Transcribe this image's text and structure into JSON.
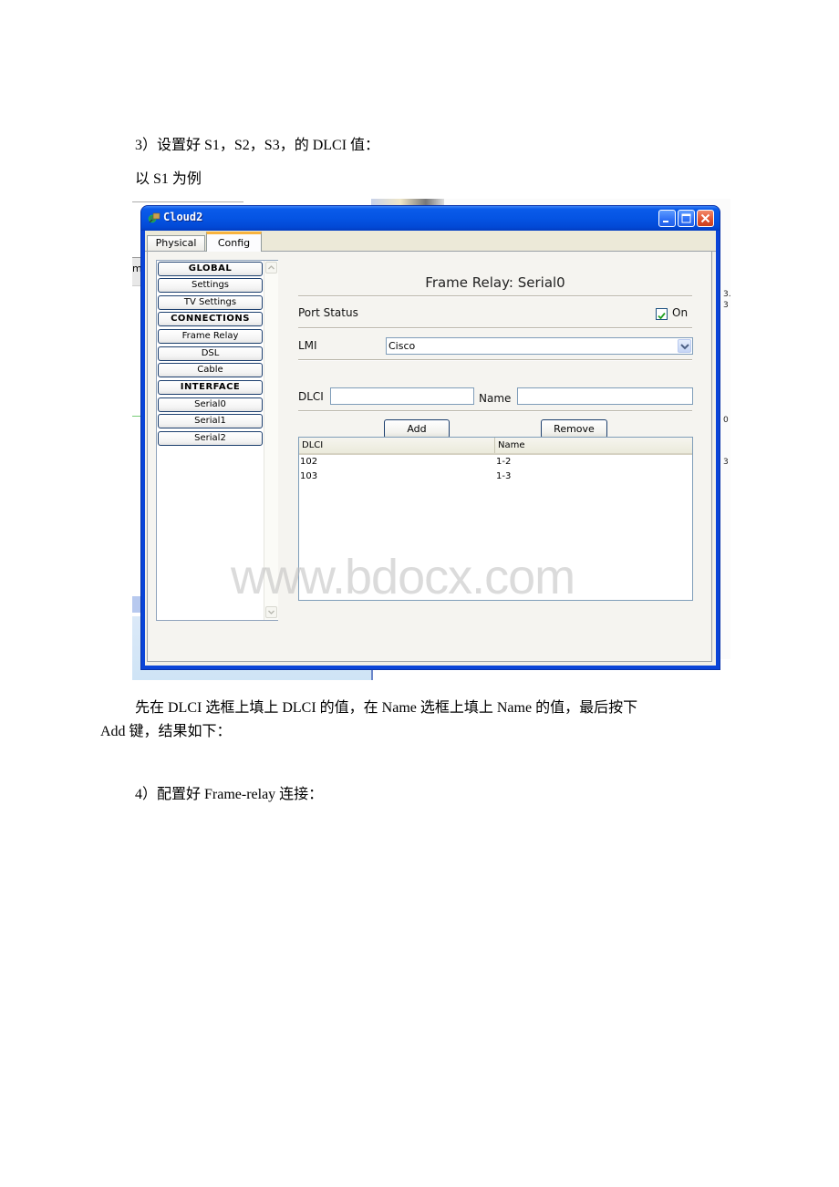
{
  "document": {
    "step3_heading": "3）设置好 S1，S2，S3，的 DLCI 值：",
    "example_line": "以 S1 为例",
    "instruction_line1": "先在 DLCI 选框上填上 DLCI 的值，在 Name 选框上填上 Name 的值，最后按下",
    "instruction_line2": "Add 键，结果如下：",
    "step4_heading": "4）配置好 Frame-relay 连接："
  },
  "window": {
    "title": "Cloud2",
    "icon": "cloud-device-icon",
    "controls": [
      "minimize",
      "maximize",
      "close"
    ]
  },
  "tabs": [
    {
      "label": "Physical",
      "active": false
    },
    {
      "label": "Config",
      "active": true
    }
  ],
  "sidebar": {
    "items": [
      {
        "label": "GLOBAL",
        "type": "header"
      },
      {
        "label": "Settings",
        "type": "item"
      },
      {
        "label": "TV Settings",
        "type": "item"
      },
      {
        "label": "CONNECTIONS",
        "type": "header"
      },
      {
        "label": "Frame Relay",
        "type": "item"
      },
      {
        "label": "DSL",
        "type": "item"
      },
      {
        "label": "Cable",
        "type": "item"
      },
      {
        "label": "INTERFACE",
        "type": "header"
      },
      {
        "label": "Serial0",
        "type": "item"
      },
      {
        "label": "Serial1",
        "type": "item"
      },
      {
        "label": "Serial2",
        "type": "item"
      }
    ]
  },
  "panel": {
    "title": "Frame Relay: Serial0",
    "port_status_label": "Port Status",
    "port_status_on_label": "On",
    "port_status_checked": true,
    "lmi_label": "LMI",
    "lmi_value": "Cisco",
    "dlci_label": "DLCI",
    "dlci_value": "",
    "name_label": "Name",
    "name_value": "",
    "add_button": "Add",
    "remove_button": "Remove",
    "table": {
      "columns": [
        "DLCI",
        "Name"
      ],
      "rows": [
        [
          "102",
          "1-2"
        ],
        [
          "103",
          "1-3"
        ]
      ]
    }
  },
  "background_fragments": {
    "left_edge_text": "m",
    "right_edge_texts": [
      "3.",
      "3",
      "0",
      "3"
    ]
  },
  "watermark": "www.bdocx.com",
  "colors": {
    "titlebar_blue": "#0554e3",
    "close_red": "#e0502d",
    "active_tab_accent": "#f8b33e",
    "checkbox_green": "#21a121"
  }
}
